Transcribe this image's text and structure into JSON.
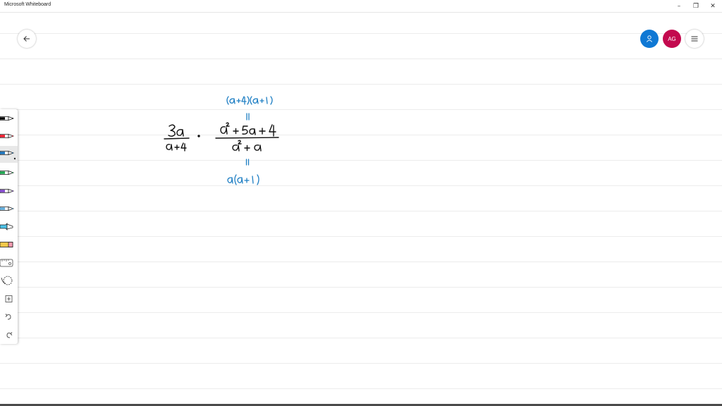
{
  "window": {
    "title": "Microsoft Whiteboard",
    "controls": {
      "minimize": "–",
      "restore": "❐",
      "close": "✕"
    }
  },
  "header": {
    "back_icon": "arrow-left-icon",
    "people_icon": "person-icon",
    "user_initials": "AG",
    "menu_icon": "hamburger-menu-icon"
  },
  "colors": {
    "people_button": "#0f78d4",
    "user_avatar": "#c3094e",
    "ink_black": "#111111",
    "ink_blue": "#1f7fc4"
  },
  "toolbar": {
    "tools": [
      {
        "name": "pen-black",
        "color": "#000000"
      },
      {
        "name": "pen-red",
        "color": "#e81224"
      },
      {
        "name": "pen-blue",
        "color": "#0f6ab4",
        "selected": true
      },
      {
        "name": "pen-green",
        "color": "#16a34a"
      },
      {
        "name": "pen-purple",
        "color": "#7a3fc4"
      },
      {
        "name": "pen-light-blue",
        "color": "#5aa8d8"
      },
      {
        "name": "highlighter",
        "color": "#4cc3e8"
      },
      {
        "name": "eraser",
        "color": "#f2c84b"
      },
      {
        "name": "ruler",
        "color": "#666666"
      },
      {
        "name": "lasso",
        "color": "#444444"
      },
      {
        "name": "add",
        "color": "#444444"
      },
      {
        "name": "undo",
        "color": "#444444"
      },
      {
        "name": "redo",
        "color": "#444444"
      }
    ]
  }
}
